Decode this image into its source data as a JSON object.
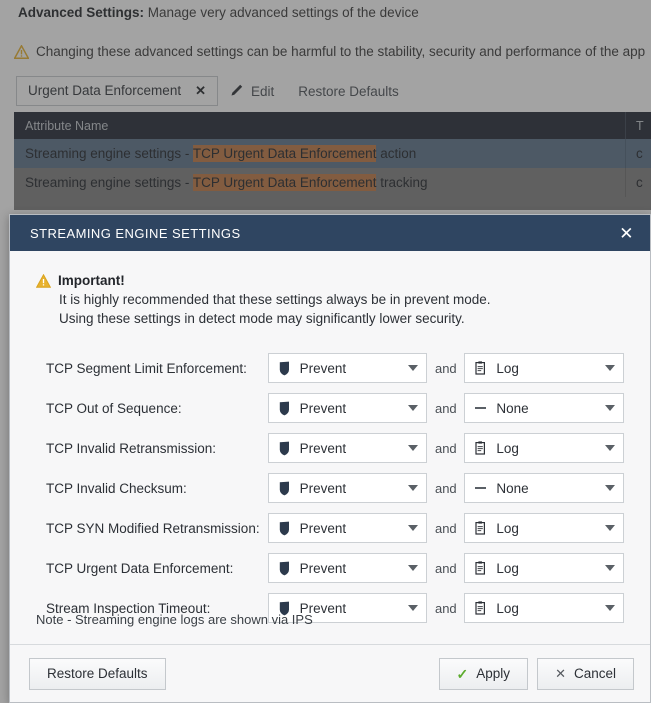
{
  "background": {
    "header_label": "Advanced Settings:",
    "header_text": " Manage very advanced settings of the device",
    "warning_text": "Changing these advanced settings can be harmful to the stability, security and performance of the app",
    "warning_icon": "warning-triangle-icon",
    "toolbar": {
      "filter_chip": "Urgent Data Enforcement",
      "filter_chip_close": "✕",
      "edit_label": "Edit",
      "edit_icon": "pencil-icon",
      "restore_defaults_label": "Restore Defaults"
    },
    "table": {
      "columns": [
        "Attribute Name",
        "T"
      ],
      "highlight_term": "TCP Urgent Data Enforcement",
      "highlight_color": "#c07a45",
      "rows": [
        {
          "prefix": "Streaming engine settings - ",
          "highlight": "TCP Urgent Data Enforcement",
          "suffix": " action",
          "col2": "c",
          "selected": true
        },
        {
          "prefix": "Streaming engine settings - ",
          "highlight": "TCP Urgent Data Enforcement",
          "suffix": " tracking",
          "col2": "c",
          "selected": false
        }
      ]
    }
  },
  "modal": {
    "title": "STREAMING ENGINE SETTINGS",
    "close_icon": "✕",
    "important": {
      "icon": "warning-triangle-icon",
      "heading": "Important!",
      "line1": "It is highly recommended that these settings always be in prevent mode.",
      "line2": "Using these settings in detect mode may significantly lower security."
    },
    "and_label": "and",
    "rows": [
      {
        "label": "TCP Segment Limit Enforcement:",
        "action": "Prevent",
        "action_icon": "shield-icon",
        "tracking": "Log",
        "tracking_icon": "log-icon"
      },
      {
        "label": "TCP Out of Sequence:",
        "action": "Prevent",
        "action_icon": "shield-icon",
        "tracking": "None",
        "tracking_icon": "dash-icon"
      },
      {
        "label": "TCP Invalid Retransmission:",
        "action": "Prevent",
        "action_icon": "shield-icon",
        "tracking": "Log",
        "tracking_icon": "log-icon"
      },
      {
        "label": "TCP Invalid Checksum:",
        "action": "Prevent",
        "action_icon": "shield-icon",
        "tracking": "None",
        "tracking_icon": "dash-icon"
      },
      {
        "label": "TCP SYN Modified Retransmission:",
        "action": "Prevent",
        "action_icon": "shield-icon",
        "tracking": "Log",
        "tracking_icon": "log-icon"
      },
      {
        "label": "TCP Urgent Data Enforcement:",
        "action": "Prevent",
        "action_icon": "shield-icon",
        "tracking": "Log",
        "tracking_icon": "log-icon"
      },
      {
        "label": "Stream Inspection Timeout:",
        "action": "Prevent",
        "action_icon": "shield-icon",
        "tracking": "Log",
        "tracking_icon": "log-icon"
      }
    ],
    "note": "Note - Streaming engine logs are shown via IPS",
    "footer": {
      "restore_defaults_label": "Restore Defaults",
      "apply_label": "Apply",
      "apply_icon": "check-icon",
      "cancel_label": "Cancel",
      "cancel_icon": "x-icon"
    }
  },
  "colors": {
    "modal_header": "#2f4561",
    "table_header": "#222936",
    "selected_row": "#5d748b",
    "highlight": "#c07a45",
    "warning_amber": "#e8b22e",
    "apply_green": "#5cab2e"
  }
}
